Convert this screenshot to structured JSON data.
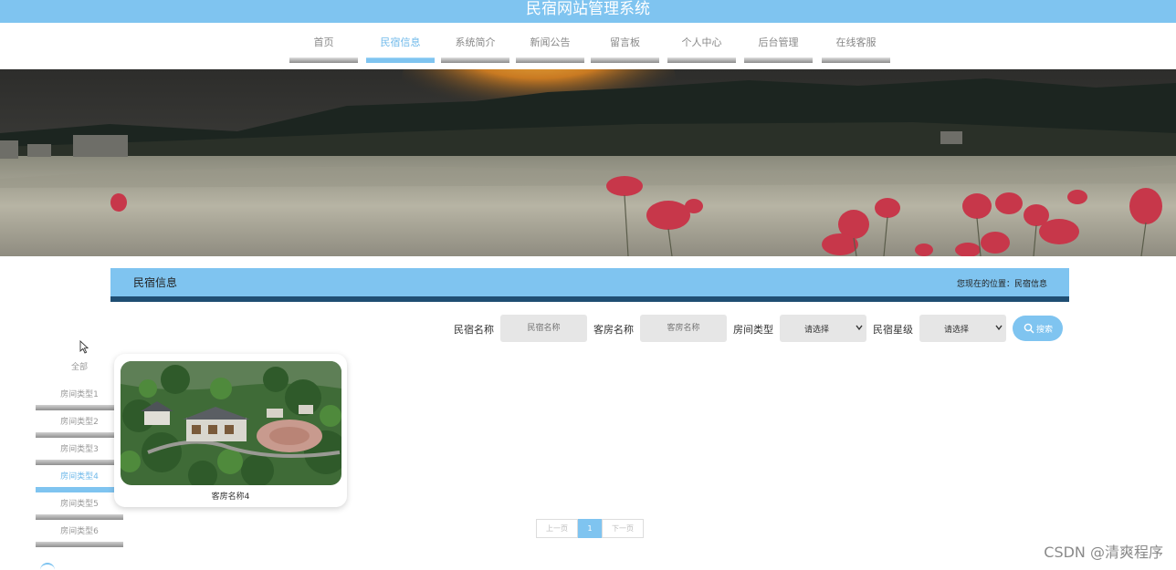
{
  "app": {
    "title": "民宿网站管理系统"
  },
  "nav": {
    "items": [
      {
        "label": "首页"
      },
      {
        "label": "民宿信息"
      },
      {
        "label": "系统简介"
      },
      {
        "label": "新闻公告"
      },
      {
        "label": "留言板"
      },
      {
        "label": "个人中心"
      },
      {
        "label": "后台管理"
      },
      {
        "label": "在线客服"
      }
    ],
    "active": "民宿信息"
  },
  "section": {
    "title": "民宿信息",
    "breadcrumb": "您现在的位置：民宿信息"
  },
  "search": {
    "minsu_label": "民宿名称",
    "minsu_placeholder": "民宿名称",
    "room_label": "客房名称",
    "room_placeholder": "客房名称",
    "type_label": "房间类型",
    "type_selected": "请选择",
    "star_label": "民宿星级",
    "star_selected": "请选择",
    "button_label": "搜索"
  },
  "sidebar": {
    "items": [
      {
        "label": "全部"
      },
      {
        "label": "房间类型1"
      },
      {
        "label": "房间类型2"
      },
      {
        "label": "房间类型3"
      },
      {
        "label": "房间类型4"
      },
      {
        "label": "房间类型5"
      },
      {
        "label": "房间类型6"
      }
    ],
    "active": "房间类型4"
  },
  "cards": [
    {
      "name": "客房名称4"
    }
  ],
  "pagination": {
    "prev": "上一页",
    "current": "1",
    "next": "下一页"
  },
  "watermark": "CSDN @清爽程序",
  "colors": {
    "accent": "#7fc4f0",
    "dark_band": "#1f4e73"
  }
}
